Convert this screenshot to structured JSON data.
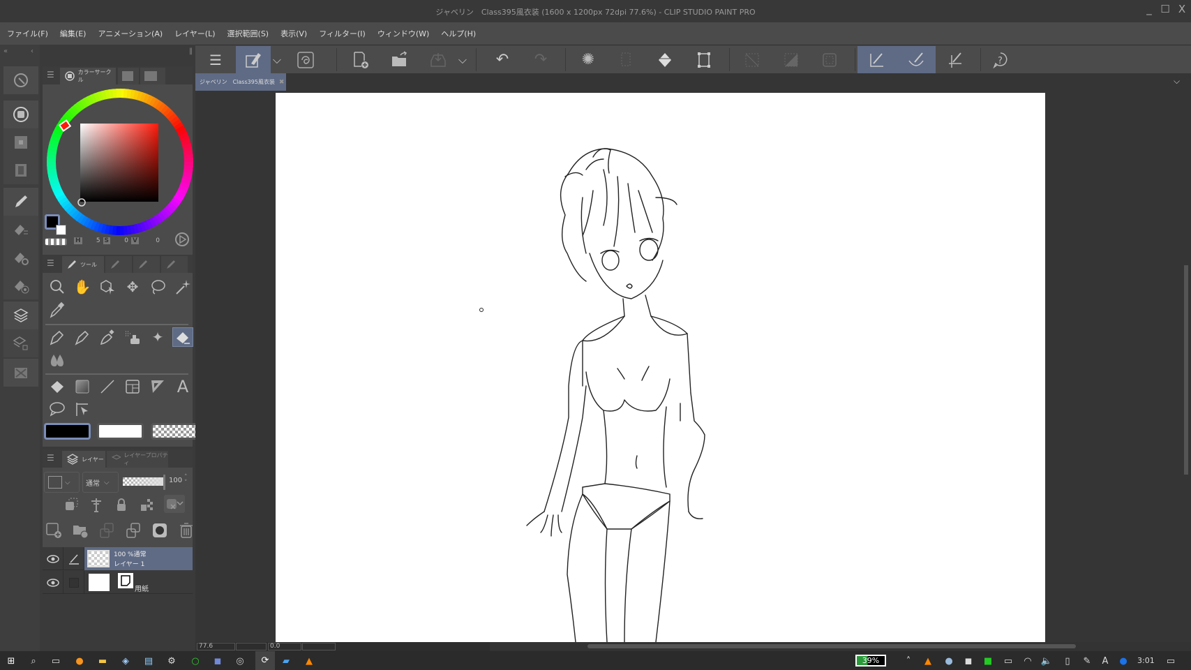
{
  "window": {
    "title": "ジャベリン　Class395風衣装 (1600 x 1200px 72dpi 77.6%)  - CLIP STUDIO PAINT PRO",
    "minimize": "_",
    "maximize": "☐",
    "close": "X"
  },
  "menu": [
    "ファイル(F)",
    "編集(E)",
    "アニメーション(A)",
    "レイヤー(L)",
    "選択範囲(S)",
    "表示(V)",
    "フィルター(I)",
    "ウィンドウ(W)",
    "ヘルプ(H)"
  ],
  "document_tab": {
    "label": "ジャベリン　Class395風衣装",
    "close": "✖"
  },
  "color_panel": {
    "tab_label": "カラーサークル",
    "h_label": "H",
    "h_value": "5",
    "s_label": "S",
    "s_value": "0",
    "v_label": "V",
    "v_value": "0",
    "main_color": "#000000",
    "sub_color": "#ffffff",
    "hue_color": "#ff1a0a"
  },
  "tool_panel": {
    "tab_label": "ツール"
  },
  "layer_panel": {
    "tab_layer": "レイヤー",
    "tab_property": "レイヤープロパティ",
    "blend_mode": "通常",
    "opacity": "100",
    "layers": [
      {
        "mode": "100 %通常",
        "name": "レイヤー 1",
        "selected": true
      },
      {
        "mode": "",
        "name": "用紙",
        "selected": false
      }
    ]
  },
  "status": {
    "zoom": "77.6",
    "angle": "0.0"
  },
  "taskbar": {
    "battery": "39%",
    "time": "3:01"
  },
  "colors": {
    "accent": "#5f6b85",
    "panel": "#4b4b4b"
  }
}
